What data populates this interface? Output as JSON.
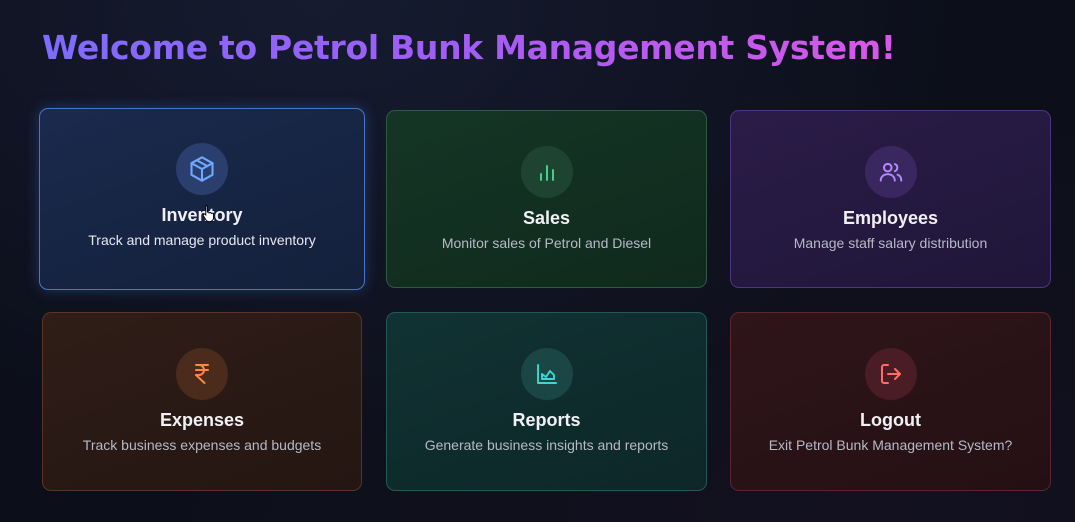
{
  "header": {
    "title": "Welcome to Petrol Bunk Management System!"
  },
  "cards": [
    {
      "title": "Inventory",
      "description": "Track and manage product inventory",
      "icon": "box-icon",
      "accent": "#6fa8ff"
    },
    {
      "title": "Sales",
      "description": "Monitor sales of Petrol and Diesel",
      "icon": "bar-chart-icon",
      "accent": "#3fd18a"
    },
    {
      "title": "Employees",
      "description": "Manage staff salary distribution",
      "icon": "users-icon",
      "accent": "#b48bff"
    },
    {
      "title": "Expenses",
      "description": "Track business expenses and budgets",
      "icon": "rupee-icon",
      "accent": "#ff8a3d"
    },
    {
      "title": "Reports",
      "description": "Generate business insights and reports",
      "icon": "area-chart-icon",
      "accent": "#3fd6d0"
    },
    {
      "title": "Logout",
      "description": "Exit Petrol Bunk Management System?",
      "icon": "logout-icon",
      "accent": "#ff6b6b"
    }
  ]
}
